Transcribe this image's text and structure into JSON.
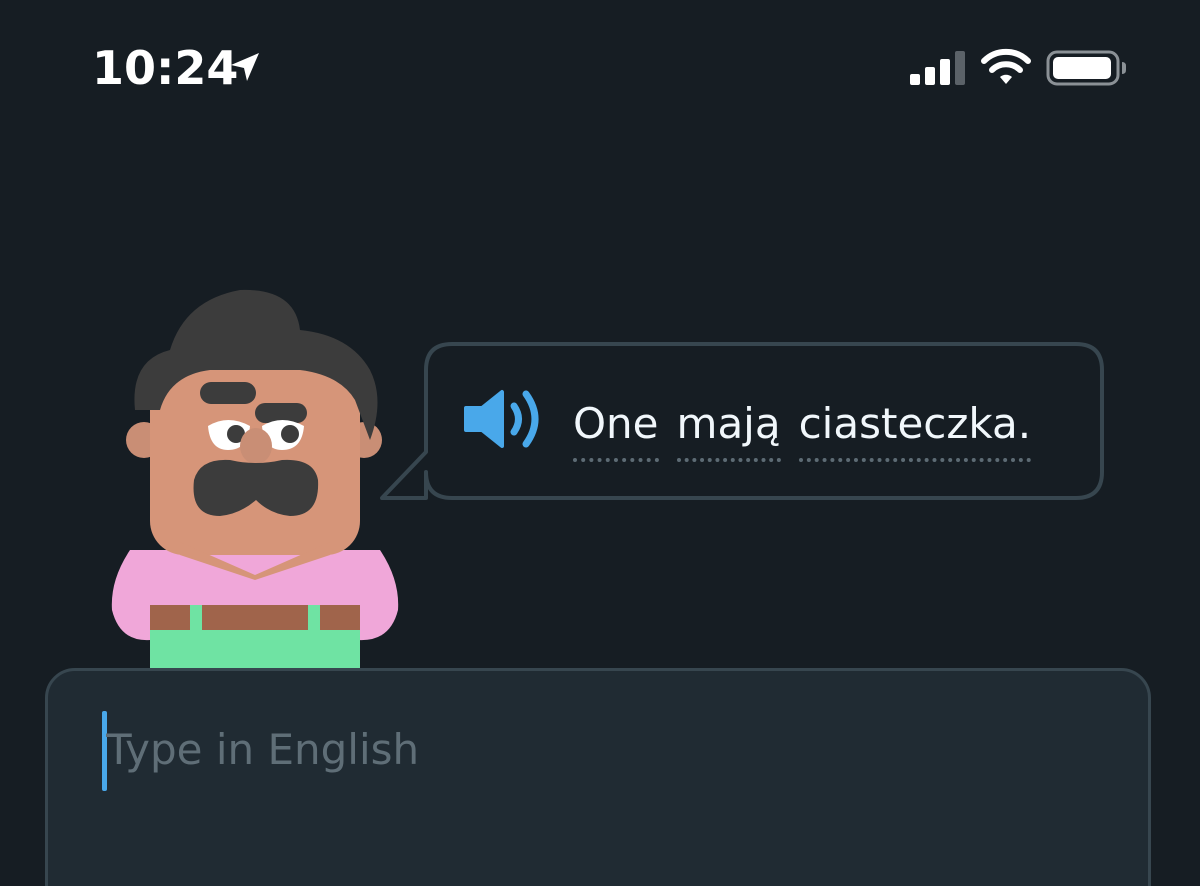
{
  "status_bar": {
    "time": "10:24",
    "icons": [
      "location-arrow-icon",
      "cellular-signal-icon",
      "wifi-icon",
      "battery-icon"
    ]
  },
  "prompt": {
    "speaker_icon": "speaker-icon",
    "words": [
      "One",
      "mają",
      "ciasteczka."
    ]
  },
  "answer": {
    "placeholder": "Type in English",
    "value": ""
  },
  "colors": {
    "background": "#161d23",
    "bubble_border": "#37464f",
    "text": "#f1f7fb",
    "accent_blue": "#49a8ea",
    "panel": "#202b33",
    "placeholder": "#5f6e77"
  }
}
